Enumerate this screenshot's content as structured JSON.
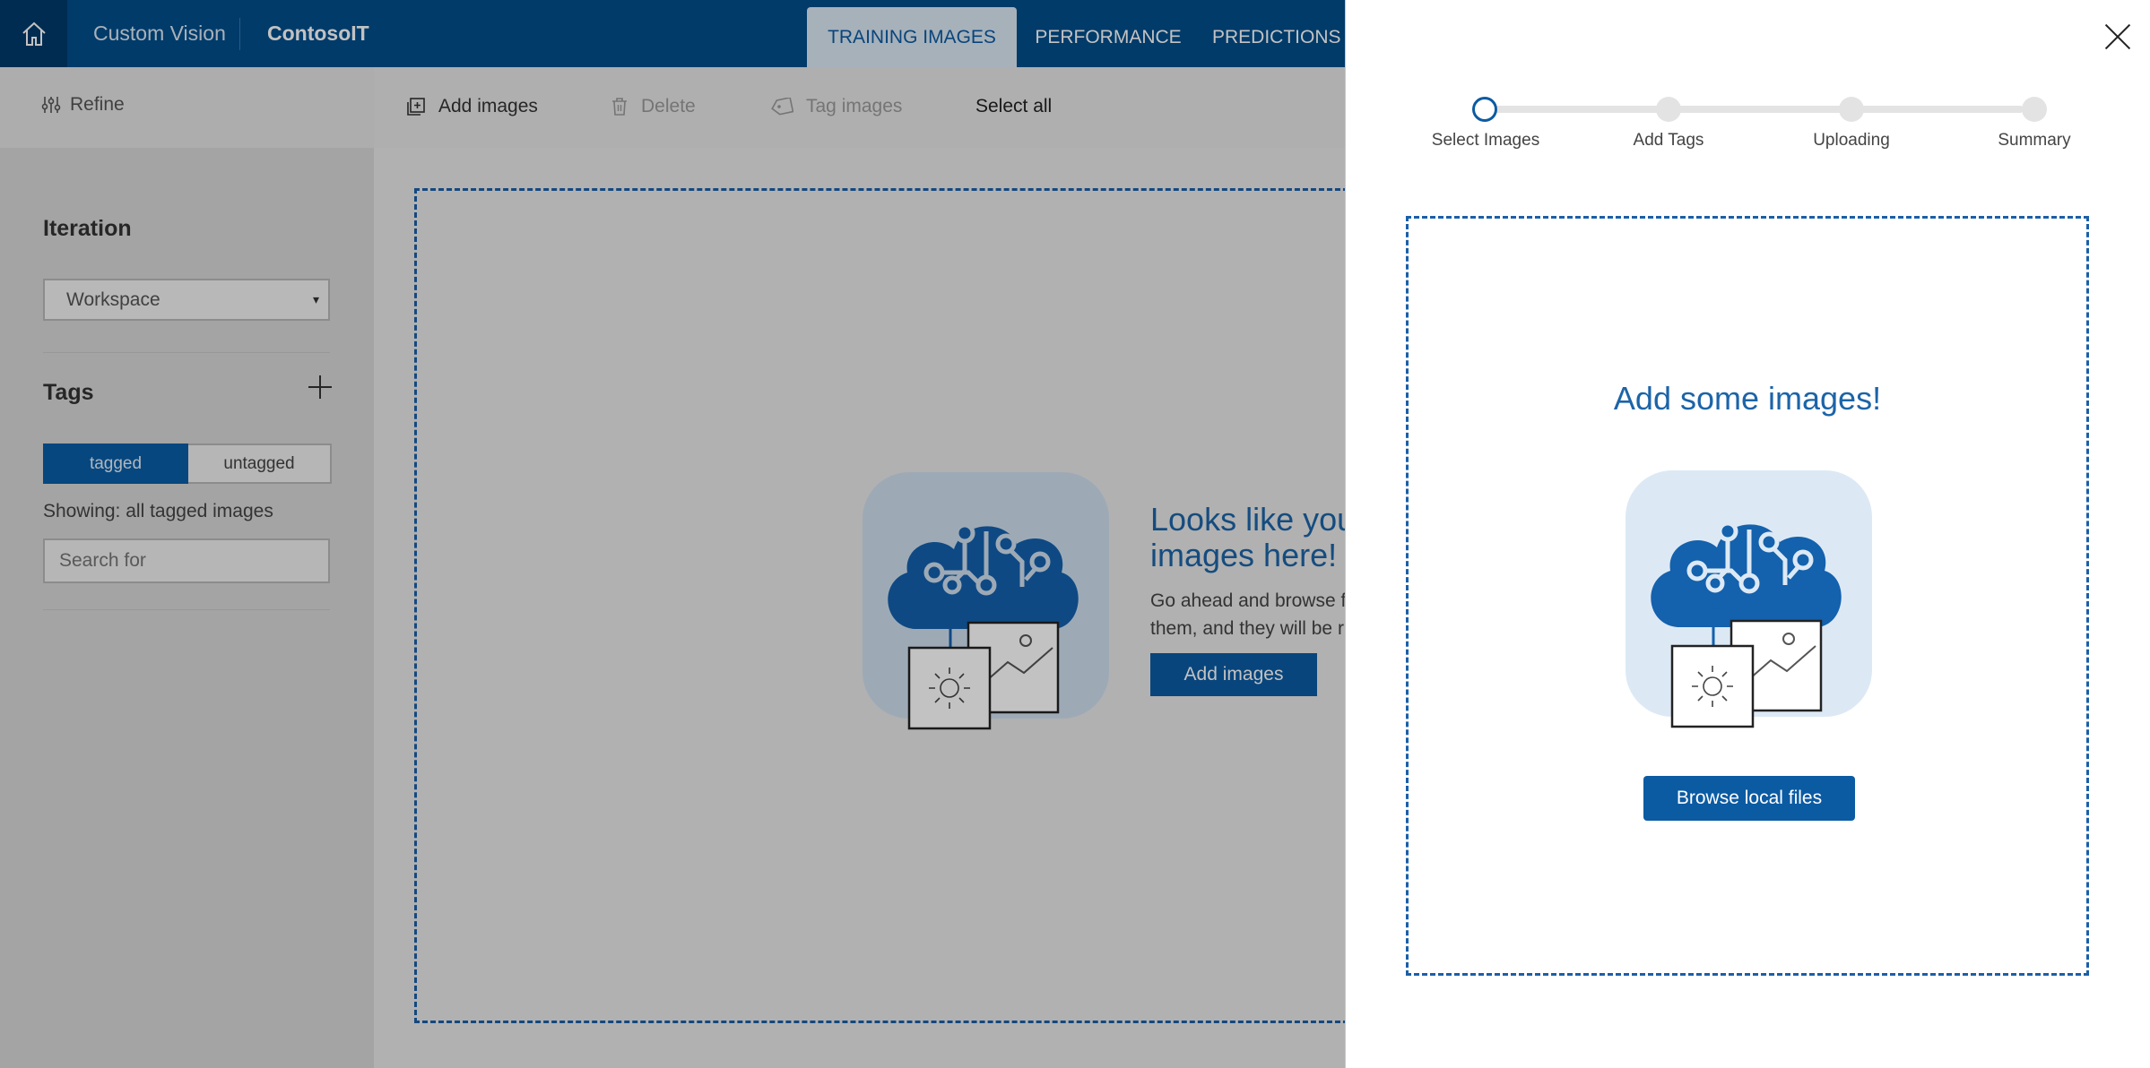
{
  "nav": {
    "home_icon": "home-icon",
    "brand": "Custom Vision",
    "project": "ContosoIT",
    "tabs": [
      {
        "label": "TRAINING IMAGES",
        "active": true
      },
      {
        "label": "PERFORMANCE",
        "active": false
      },
      {
        "label": "PREDICTIONS",
        "active": false
      }
    ]
  },
  "sidebar": {
    "refine_label": "Refine",
    "iteration_title": "Iteration",
    "iteration_value": "Workspace",
    "tags_title": "Tags",
    "toggle": {
      "tagged": "tagged",
      "untagged": "untagged"
    },
    "showing": "Showing: all tagged images",
    "search_placeholder": "Search for"
  },
  "toolbar": {
    "add_images": "Add images",
    "delete": "Delete",
    "tag_images": "Tag images",
    "select_all": "Select all"
  },
  "main": {
    "empty_title_line1": "Looks like you",
    "empty_title_line2": "images here!",
    "empty_text_line1": "Go ahead and browse f",
    "empty_text_line2": "them, and they will be r",
    "add_images_button": "Add images"
  },
  "panel": {
    "steps": [
      "Select Images",
      "Add Tags",
      "Uploading",
      "Summary"
    ],
    "active_step": 0,
    "title": "Add some images!",
    "browse_button": "Browse local files"
  },
  "colors": {
    "accent": "#0b5ba3",
    "topbar": "#004e8c",
    "illustration_bg": "#dce9f5"
  }
}
